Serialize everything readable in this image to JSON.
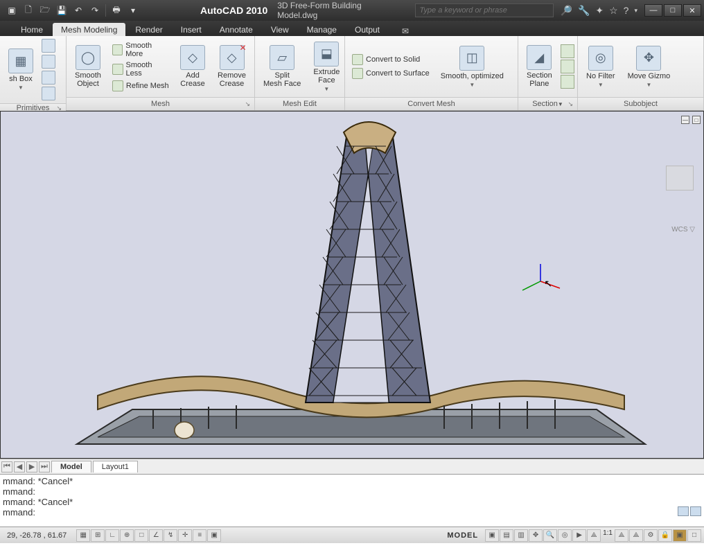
{
  "titlebar": {
    "app": "AutoCAD 2010",
    "file": "3D Free-Form Building Model.dwg",
    "search_placeholder": "Type a keyword or phrase"
  },
  "tabs": [
    "Home",
    "Mesh Modeling",
    "Render",
    "Insert",
    "Annotate",
    "View",
    "Manage",
    "Output"
  ],
  "active_tab": "Mesh Modeling",
  "ribbon": {
    "primitives": {
      "title": "Primitives",
      "meshbox": "sh Box"
    },
    "mesh": {
      "title": "Mesh",
      "smooth_object": "Smooth\nObject",
      "smooth_more": "Smooth More",
      "smooth_less": "Smooth Less",
      "refine_mesh": "Refine Mesh",
      "add_crease": "Add\nCrease",
      "remove_crease": "Remove\nCrease"
    },
    "meshedit": {
      "title": "Mesh Edit",
      "split_face": "Split\nMesh Face",
      "extrude_face": "Extrude\nFace"
    },
    "convert": {
      "title": "Convert Mesh",
      "to_solid": "Convert to Solid",
      "to_surface": "Convert to Surface",
      "smooth_opt": "Smooth, optimized"
    },
    "section": {
      "title": "Section",
      "section_plane": "Section\nPlane"
    },
    "subobject": {
      "title": "Subobject",
      "no_filter": "No Filter",
      "move_gizmo": "Move Gizmo"
    }
  },
  "viewport": {
    "wcs": "WCS ▽"
  },
  "layout_tabs": [
    "Model",
    "Layout1"
  ],
  "command_lines": [
    "mmand: *Cancel*",
    "mmand:",
    "mmand: *Cancel*",
    "mmand:"
  ],
  "status": {
    "coords": "29,  -26.78 , 61.67",
    "model": "MODEL",
    "scale": "1:1"
  }
}
